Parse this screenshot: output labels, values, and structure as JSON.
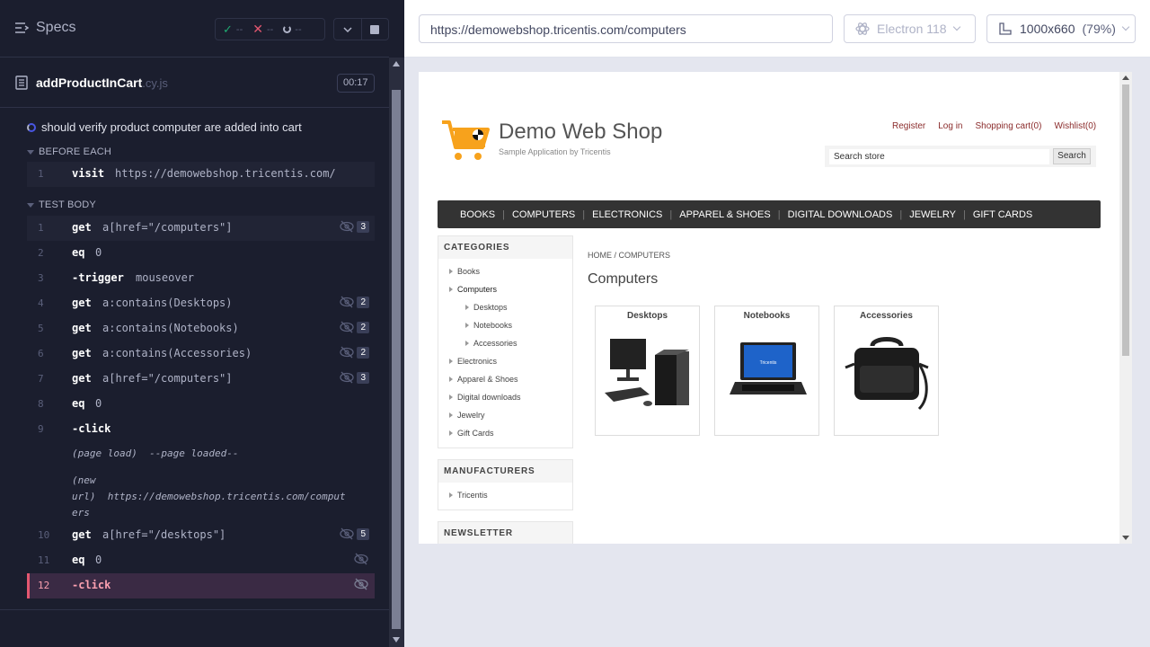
{
  "reporter": {
    "specs_label": "Specs",
    "stats": {
      "passed": "--",
      "failed": "--",
      "pending": "--"
    },
    "spec_file": {
      "name": "addProductInCart",
      "ext": ".cy.js",
      "duration": "00:17"
    },
    "test_title": "should verify product computer are added into cart",
    "before_each": {
      "label": "BEFORE EACH",
      "commands": [
        {
          "num": "1",
          "name": "visit",
          "arg": "https://demowebshop.tricentis.com/"
        }
      ]
    },
    "test_body": {
      "label": "TEST BODY",
      "commands": [
        {
          "num": "1",
          "name": "get",
          "arg": "a[href=\"/computers\"]",
          "count": "3"
        },
        {
          "num": "2",
          "name": "eq",
          "arg": "0"
        },
        {
          "num": "3",
          "name": "-trigger",
          "arg": "mouseover"
        },
        {
          "num": "4",
          "name": "get",
          "arg": "a:contains(Desktops)",
          "count": "2"
        },
        {
          "num": "5",
          "name": "get",
          "arg": "a:contains(Notebooks)",
          "count": "2"
        },
        {
          "num": "6",
          "name": "get",
          "arg": "a:contains(Accessories)",
          "count": "2"
        },
        {
          "num": "7",
          "name": "get",
          "arg": "a[href=\"/computers\"]",
          "count": "3"
        },
        {
          "num": "8",
          "name": "eq",
          "arg": "0"
        },
        {
          "num": "9",
          "name": "-click",
          "arg": ""
        },
        {
          "num": "10",
          "name": "get",
          "arg": "a[href=\"/desktops\"]",
          "count": "5"
        },
        {
          "num": "11",
          "name": "eq",
          "arg": "0"
        },
        {
          "num": "12",
          "name": "-click",
          "arg": ""
        }
      ],
      "events": {
        "page_load_label": "(page load)",
        "page_load_msg": "--page loaded--",
        "new_url_label_1": "(new",
        "new_url_label_2": "url)",
        "new_url_msg_1": "https://demowebshop.tricentis.com/comput",
        "new_url_msg_2": "ers"
      }
    }
  },
  "aut": {
    "url": "https://demowebshop.tricentis.com/computers",
    "browser": "Electron 118",
    "viewport": "1000x660",
    "zoom": "(79%)"
  },
  "shop": {
    "title": "Demo Web Shop",
    "subtitle": "Sample Application by Tricentis",
    "top_links": [
      "Register",
      "Log in",
      "Shopping cart(0)",
      "Wishlist(0)"
    ],
    "search_placeholder": "Search store",
    "search_button": "Search",
    "nav": [
      "BOOKS",
      "COMPUTERS",
      "ELECTRONICS",
      "APPAREL & SHOES",
      "DIGITAL DOWNLOADS",
      "JEWELRY",
      "GIFT CARDS"
    ],
    "categories_title": "CATEGORIES",
    "categories": [
      {
        "label": "Books",
        "sub": false
      },
      {
        "label": "Computers",
        "sub": false
      },
      {
        "label": "Desktops",
        "sub": true
      },
      {
        "label": "Notebooks",
        "sub": true
      },
      {
        "label": "Accessories",
        "sub": true
      },
      {
        "label": "Electronics",
        "sub": false
      },
      {
        "label": "Apparel & Shoes",
        "sub": false
      },
      {
        "label": "Digital downloads",
        "sub": false
      },
      {
        "label": "Jewelry",
        "sub": false
      },
      {
        "label": "Gift Cards",
        "sub": false
      }
    ],
    "manufacturers_title": "MANUFACTURERS",
    "manufacturers": [
      "Tricentis"
    ],
    "newsletter_title": "NEWSLETTER",
    "breadcrumb": "HOME / COMPUTERS",
    "page_title": "Computers",
    "cards": [
      "Desktops",
      "Notebooks",
      "Accessories"
    ],
    "accent_color": "#f7a21c",
    "nav_color": "#333333"
  }
}
